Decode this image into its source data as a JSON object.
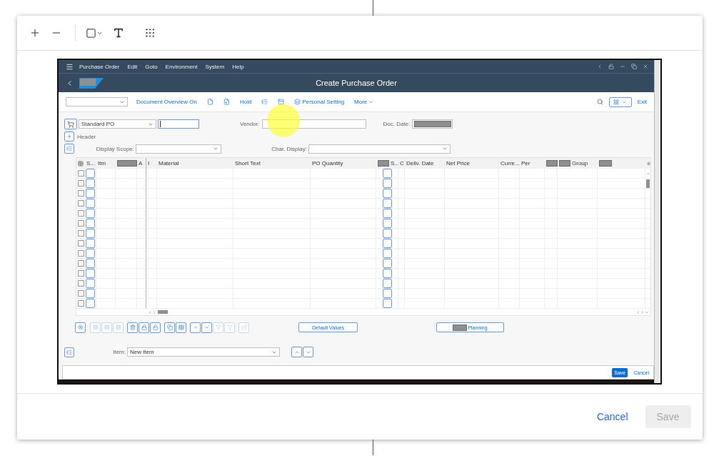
{
  "editor": {
    "cancel": "Cancel",
    "save": {
      "label": "Save",
      "disabled": true
    }
  },
  "sap": {
    "menu": [
      "Purchase Order",
      "Edit",
      "Goto",
      "Environment",
      "System",
      "Help"
    ],
    "title": "Create Purchase Order",
    "toolbar": {
      "overview": "Document Overview On",
      "hold": "Hold",
      "personal": "Personal Setting",
      "more": "More",
      "exit": "Exit"
    },
    "header_row": {
      "order_type": "Standard PO",
      "vendor_label": "Vendor:",
      "doc_date_label": "Doc. Date:"
    },
    "header_toggle": "Header",
    "display_scope_label": "Display Scope:",
    "char_display_label": "Char. Display:",
    "table": {
      "columns": [
        {
          "label": "S...",
          "kind": "input"
        },
        {
          "label": "Itm",
          "kind": "text"
        },
        {
          "redacted": true,
          "kind": "text"
        },
        {
          "label": "A",
          "kind": "text"
        },
        {
          "label": "I",
          "kind": "text"
        },
        {
          "label": "Material",
          "kind": "text"
        },
        {
          "label": "Short Text",
          "kind": "text"
        },
        {
          "label": "PO Quantity",
          "kind": "text"
        },
        {
          "label": "S...",
          "redacted": true,
          "kind": "input"
        },
        {
          "label": "C",
          "kind": "text"
        },
        {
          "label": "Deliv. Date",
          "kind": "text"
        },
        {
          "label": "Net Price",
          "kind": "text"
        },
        {
          "label": "Curre...",
          "kind": "text"
        },
        {
          "label": "Per",
          "kind": "text"
        },
        {
          "redacted": true,
          "kind": "text"
        },
        {
          "label": "Group",
          "redacted": true,
          "kind": "text"
        },
        {
          "redacted": true,
          "kind": "text"
        }
      ],
      "rows": [
        {
          "selected": false
        },
        {
          "selected": false
        },
        {
          "selected": false
        },
        {
          "selected": false
        },
        {
          "selected": false
        },
        {
          "selected": false
        },
        {
          "selected": false
        },
        {
          "selected": false
        },
        {
          "selected": false
        },
        {
          "selected": false
        },
        {
          "selected": false
        },
        {
          "selected": false
        },
        {
          "selected": false
        },
        {
          "selected": false
        }
      ]
    },
    "buttons": [
      {
        "label": "Default Values",
        "redacted": false
      },
      {
        "label": "Planning",
        "redacted": true
      }
    ],
    "item": {
      "label": "Item:",
      "value": "New Item"
    },
    "status_bar": {
      "save": "Save",
      "cancel": "Cancel"
    }
  }
}
